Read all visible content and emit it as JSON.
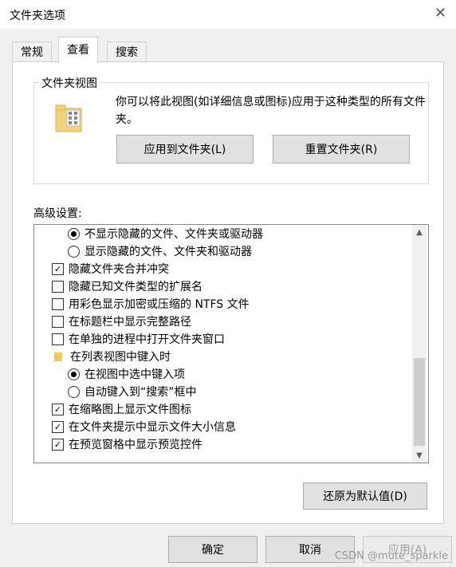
{
  "window": {
    "title": "文件夹选项"
  },
  "tabs": [
    "常规",
    "查看",
    "搜索"
  ],
  "folder_views": {
    "group_title": "文件夹视图",
    "description": "你可以将此视图(如详细信息或图标)应用于这种类型的所有文件夹。",
    "apply_button": "应用到文件夹(L)",
    "reset_button": "重置文件夹(R)"
  },
  "advanced": {
    "label": "高级设置:",
    "items": [
      {
        "type": "radio",
        "checked": true,
        "label": "不显示隐藏的文件、文件夹或驱动器"
      },
      {
        "type": "radio",
        "checked": false,
        "label": "显示隐藏的文件、文件夹和驱动器"
      },
      {
        "type": "check",
        "checked": true,
        "label": "隐藏文件夹合并冲突"
      },
      {
        "type": "check",
        "checked": false,
        "label": "隐藏已知文件类型的扩展名"
      },
      {
        "type": "check",
        "checked": false,
        "label": "用彩色显示加密或压缩的 NTFS 文件"
      },
      {
        "type": "check",
        "checked": false,
        "label": "在标题栏中显示完整路径"
      },
      {
        "type": "check",
        "checked": false,
        "label": "在单独的进程中打开文件夹窗口"
      },
      {
        "type": "folder",
        "label": "在列表视图中键入时"
      },
      {
        "type": "radio",
        "checked": true,
        "label": "在视图中选中键入项"
      },
      {
        "type": "radio",
        "checked": false,
        "label": "自动键入到“搜索”框中"
      },
      {
        "type": "check",
        "checked": true,
        "label": "在缩略图上显示文件图标"
      },
      {
        "type": "check",
        "checked": true,
        "label": "在文件夹提示中显示文件大小信息"
      },
      {
        "type": "check",
        "checked": true,
        "label": "在预览窗格中显示预览控件"
      }
    ]
  },
  "restore_button": "还原为默认值(D)",
  "footer": {
    "ok": "确定",
    "cancel": "取消",
    "apply": "应用(A)"
  },
  "watermark": "CSDN @mute_sparkle"
}
